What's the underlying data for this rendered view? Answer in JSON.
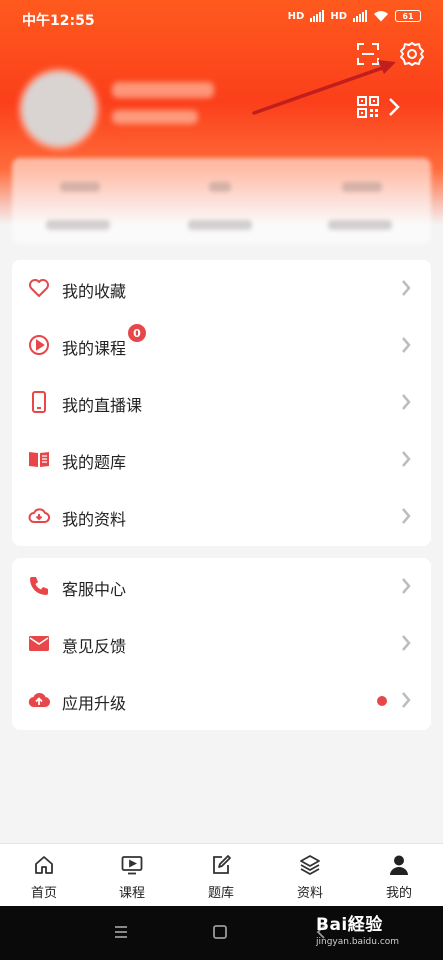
{
  "status_bar": {
    "time": "中午12:55",
    "signal_1": "HD",
    "signal_2": "HD",
    "battery": "61"
  },
  "header": {
    "scan_icon": "scan-icon",
    "settings_icon": "gear-icon",
    "qr_icon": "qrcode-icon"
  },
  "menu_group_1": [
    {
      "label": "我的收藏",
      "icon": "heart-icon"
    },
    {
      "label": "我的课程",
      "icon": "play-circle-icon",
      "badge": "0"
    },
    {
      "label": "我的直播课",
      "icon": "phone-icon"
    },
    {
      "label": "我的题库",
      "icon": "book-icon"
    },
    {
      "label": "我的资料",
      "icon": "cloud-download-icon"
    }
  ],
  "menu_group_2": [
    {
      "label": "客服中心",
      "icon": "phone-call-icon"
    },
    {
      "label": "意见反馈",
      "icon": "mail-icon"
    },
    {
      "label": "应用升级",
      "icon": "cloud-upload-icon"
    }
  ],
  "tabs": [
    {
      "label": "首页",
      "icon": "home-icon"
    },
    {
      "label": "课程",
      "icon": "tv-icon"
    },
    {
      "label": "题库",
      "icon": "edit-icon"
    },
    {
      "label": "资料",
      "icon": "layers-icon"
    },
    {
      "label": "我的",
      "icon": "user-icon",
      "active": true
    }
  ],
  "watermark": {
    "brand": "Bai経验",
    "url": "jingyan.baidu.com"
  },
  "colors": {
    "header_red": "#fb3f1a",
    "accent": "#e8474a",
    "chevron": "#bdbdbd"
  }
}
